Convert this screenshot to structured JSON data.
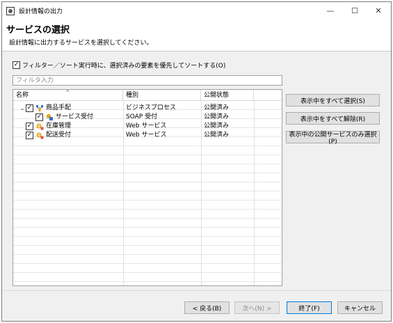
{
  "window": {
    "title": "設計情報の出力",
    "minimize_glyph": "—",
    "maximize_glyph": "☐",
    "close_glyph": "✕"
  },
  "header": {
    "title": "サービスの選択",
    "description": "設計情報に出力するサービスを選択してください。"
  },
  "options": {
    "prefer_selected_label": "フィルター／ソート実行時に、選択済みの要素を優先してソートする(O)",
    "prefer_selected_checked": true
  },
  "filter": {
    "placeholder": "フィルタ入力",
    "value": ""
  },
  "table": {
    "columns": [
      "名称",
      "種別",
      "公開状態"
    ],
    "sort_indicator": "^",
    "rows": [
      {
        "name": "商品手配",
        "type": "ビジネスプロセス",
        "status": "公開済み",
        "checked": true,
        "expanded": true,
        "indent": 0,
        "icon": "business-process-icon"
      },
      {
        "name": "サービス受付",
        "type": "SOAP 受付",
        "status": "公開済み",
        "checked": true,
        "expanded": false,
        "indent": 1,
        "icon": "soap-service-icon"
      },
      {
        "name": "在庫管理",
        "type": "Web サービス",
        "status": "公開済み",
        "checked": true,
        "expanded": false,
        "indent": 0,
        "icon": "web-service-icon"
      },
      {
        "name": "配送受付",
        "type": "Web サービス",
        "status": "公開済み",
        "checked": true,
        "expanded": false,
        "indent": 0,
        "icon": "web-service-icon"
      }
    ]
  },
  "side_buttons": {
    "select_all": "表示中をすべて選択(S)",
    "deselect_all": "表示中をすべて解除(R)",
    "select_published": "表示中の公開サービスのみ選択(P)"
  },
  "footer": {
    "back": "< 戻る(B)",
    "next": "次へ(N) >",
    "finish": "終了(F)",
    "cancel": "キャンセル"
  },
  "colors": {
    "accent": "#0078d7",
    "icon_orange": "#e8a317",
    "icon_blue": "#2f6fd0"
  }
}
